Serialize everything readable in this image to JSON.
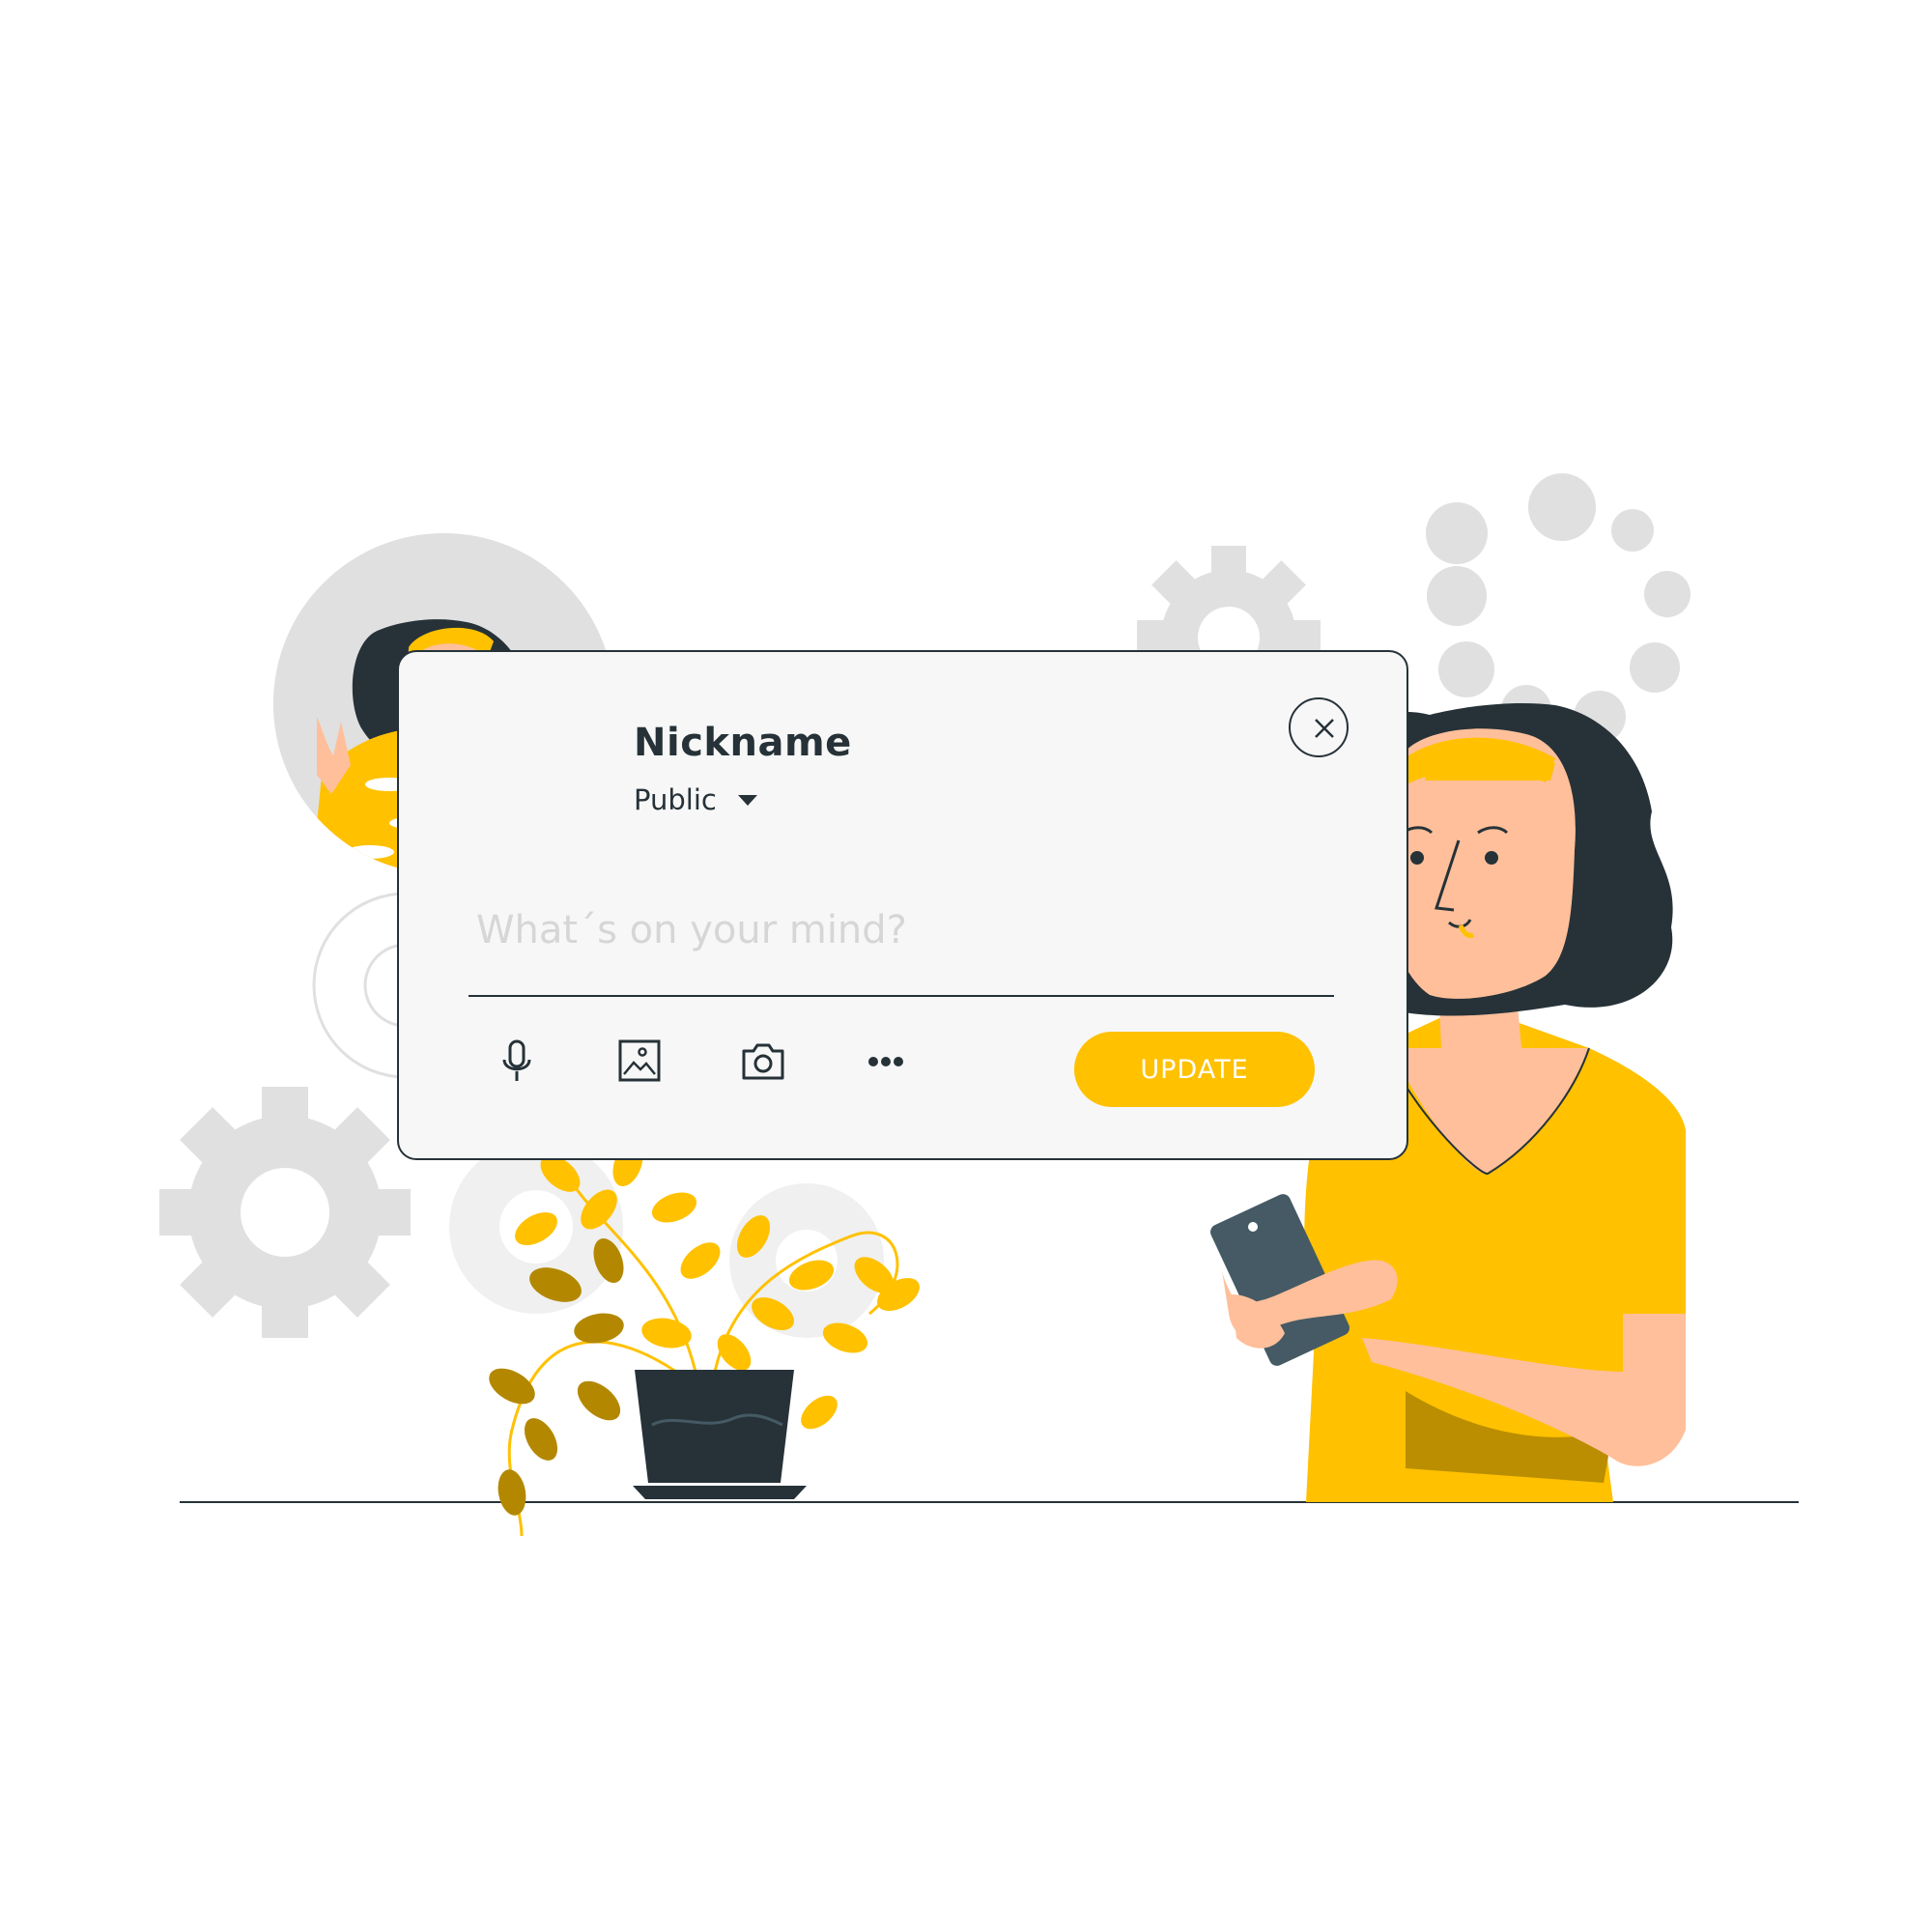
{
  "colors": {
    "accent": "#ffc100",
    "accent_dark": "#b38800",
    "ink": "#263238",
    "skin": "#ffbf9a",
    "gear_gray": "#e0e0e0",
    "card_bg": "#f7f7f7"
  },
  "post": {
    "nickname": "Nickname",
    "privacy": "Public",
    "placeholder": "What´s on your mind?",
    "update_label": "UPDATE"
  },
  "icons": {
    "close": "close-icon",
    "dropdown": "caret-down-icon",
    "microphone": "microphone-icon",
    "image": "image-icon",
    "camera": "camera-icon",
    "more": "more-icon"
  }
}
